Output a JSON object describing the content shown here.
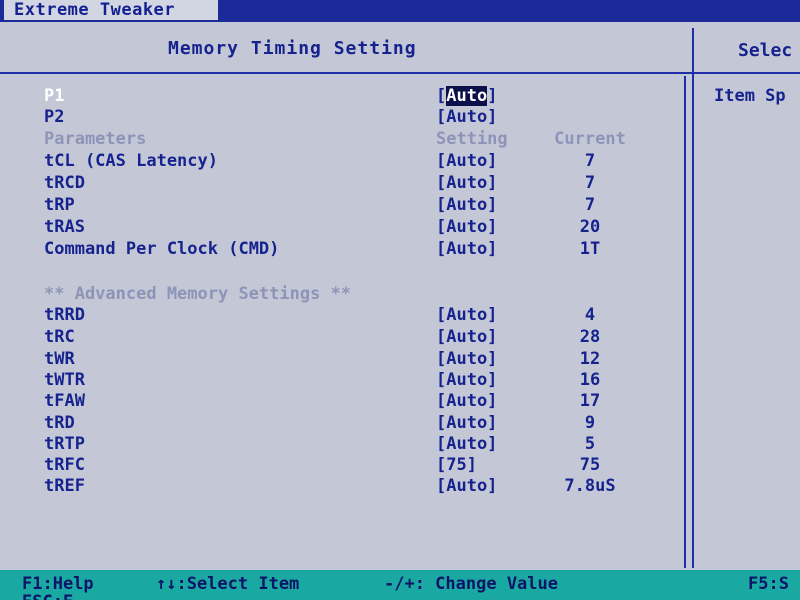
{
  "tab": {
    "label": "Extreme Tweaker"
  },
  "panel": {
    "title": "Memory Timing Setting"
  },
  "help": {
    "title": "Selec",
    "text": "Item Sp"
  },
  "rows": [
    {
      "label": "P1",
      "setting": "[Auto]",
      "current": ""
    },
    {
      "label": "P2",
      "setting": "[Auto]",
      "current": ""
    },
    {
      "label": "Parameters",
      "setting": "Setting",
      "current": "Current"
    },
    {
      "label": "tCL (CAS Latency)",
      "setting": "[Auto]",
      "current": "7"
    },
    {
      "label": "tRCD",
      "setting": "[Auto]",
      "current": "7"
    },
    {
      "label": "tRP",
      "setting": "[Auto]",
      "current": "7"
    },
    {
      "label": "tRAS",
      "setting": "[Auto]",
      "current": "20"
    },
    {
      "label": "Command Per Clock (CMD)",
      "setting": "[Auto]",
      "current": "1T"
    },
    {
      "label": "** Advanced Memory Settings **",
      "setting": "",
      "current": ""
    },
    {
      "label": "tRRD",
      "setting": "[Auto]",
      "current": "4"
    },
    {
      "label": "tRC",
      "setting": "[Auto]",
      "current": "28"
    },
    {
      "label": "tWR",
      "setting": "[Auto]",
      "current": "12"
    },
    {
      "label": "tWTR",
      "setting": "[Auto]",
      "current": "16"
    },
    {
      "label": "tFAW",
      "setting": "[Auto]",
      "current": "17"
    },
    {
      "label": "tRD",
      "setting": "[Auto]",
      "current": "9"
    },
    {
      "label": "tRTP",
      "setting": "[Auto]",
      "current": "5"
    },
    {
      "label": "tRFC",
      "setting": "[75]",
      "current": "75"
    },
    {
      "label": "tREF",
      "setting": "[Auto]",
      "current": "7.8uS"
    }
  ],
  "footer": {
    "help": "F1:Help",
    "select": "↑↓:Select Item",
    "change": "-/+: Change Value",
    "f5": "F5:S",
    "esc": "ESC:E"
  },
  "colors": {
    "background": "#c4c8d6",
    "text": "#16238f",
    "dim_text": "#8e94b8",
    "footer_bg": "#1aa9a2",
    "tab_bar": "#1b2a9a"
  }
}
